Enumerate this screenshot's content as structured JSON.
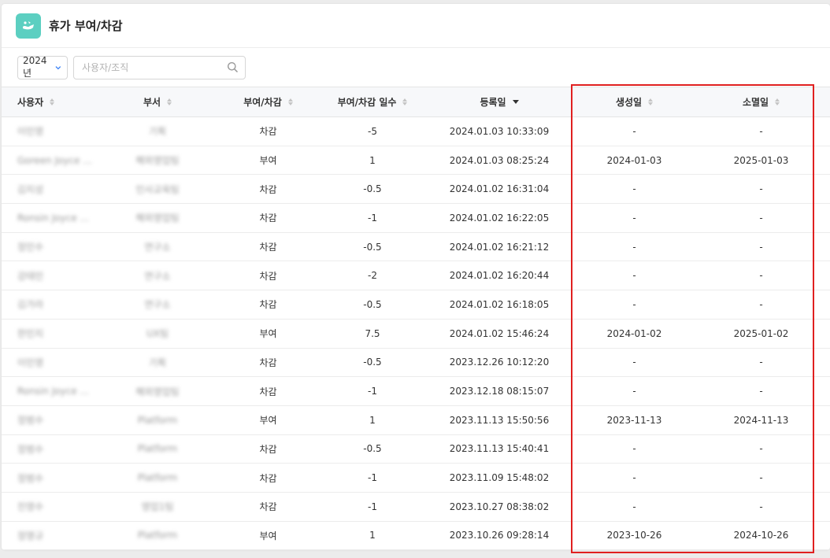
{
  "header": {
    "title": "휴가 부여/차감",
    "logo_icon": "leave-briefcase-icon"
  },
  "filters": {
    "year": "2024년",
    "search_placeholder": "사용자/조직"
  },
  "table": {
    "columns": [
      "사용자",
      "부서",
      "부여/차감",
      "부여/차감 일수",
      "등록일",
      "생성일",
      "소멸일"
    ],
    "rows": [
      {
        "user": "이민영",
        "dept": "기획",
        "type": "차감",
        "days": "-5",
        "registered": "2024.01.03 10:33:09",
        "created": "-",
        "expires": "-"
      },
      {
        "user": "Goreen Joyce ...",
        "dept": "해외영업팀",
        "type": "부여",
        "days": "1",
        "registered": "2024.01.03 08:25:24",
        "created": "2024-01-03",
        "expires": "2025-01-03"
      },
      {
        "user": "김지성",
        "dept": "인사교육팀",
        "type": "차감",
        "days": "-0.5",
        "registered": "2024.01.02 16:31:04",
        "created": "-",
        "expires": "-"
      },
      {
        "user": "Ronsin Joyce ...",
        "dept": "해외영업팀",
        "type": "차감",
        "days": "-1",
        "registered": "2024.01.02 16:22:05",
        "created": "-",
        "expires": "-"
      },
      {
        "user": "정민수",
        "dept": "연구소",
        "type": "차감",
        "days": "-0.5",
        "registered": "2024.01.02 16:21:12",
        "created": "-",
        "expires": "-"
      },
      {
        "user": "강태민",
        "dept": "연구소",
        "type": "차감",
        "days": "-2",
        "registered": "2024.01.02 16:20:44",
        "created": "-",
        "expires": "-"
      },
      {
        "user": "김가라",
        "dept": "연구소",
        "type": "차감",
        "days": "-0.5",
        "registered": "2024.01.02 16:18:05",
        "created": "-",
        "expires": "-"
      },
      {
        "user": "한민지",
        "dept": "UX팀",
        "type": "부여",
        "days": "7.5",
        "registered": "2024.01.02 15:46:24",
        "created": "2024-01-02",
        "expires": "2025-01-02"
      },
      {
        "user": "이민영",
        "dept": "기획",
        "type": "차감",
        "days": "-0.5",
        "registered": "2023.12.26 10:12:20",
        "created": "-",
        "expires": "-"
      },
      {
        "user": "Ronsin Joyce ...",
        "dept": "해외영업팀",
        "type": "차감",
        "days": "-1",
        "registered": "2023.12.18 08:15:07",
        "created": "-",
        "expires": "-"
      },
      {
        "user": "정범수",
        "dept": "Platform",
        "type": "부여",
        "days": "1",
        "registered": "2023.11.13 15:50:56",
        "created": "2023-11-13",
        "expires": "2024-11-13"
      },
      {
        "user": "정범수",
        "dept": "Platform",
        "type": "차감",
        "days": "-0.5",
        "registered": "2023.11.13 15:40:41",
        "created": "-",
        "expires": "-"
      },
      {
        "user": "정범수",
        "dept": "Platform",
        "type": "차감",
        "days": "-1",
        "registered": "2023.11.09 15:48:02",
        "created": "-",
        "expires": "-"
      },
      {
        "user": "진영수",
        "dept": "영업1팀",
        "type": "차감",
        "days": "-1",
        "registered": "2023.10.27 08:38:02",
        "created": "-",
        "expires": "-"
      },
      {
        "user": "정명규",
        "dept": "Platform",
        "type": "부여",
        "days": "1",
        "registered": "2023.10.26 09:28:14",
        "created": "2023-10-26",
        "expires": "2024-10-26"
      }
    ]
  },
  "highlight_color": "#e02020",
  "accent_color": "#5ccfc1"
}
